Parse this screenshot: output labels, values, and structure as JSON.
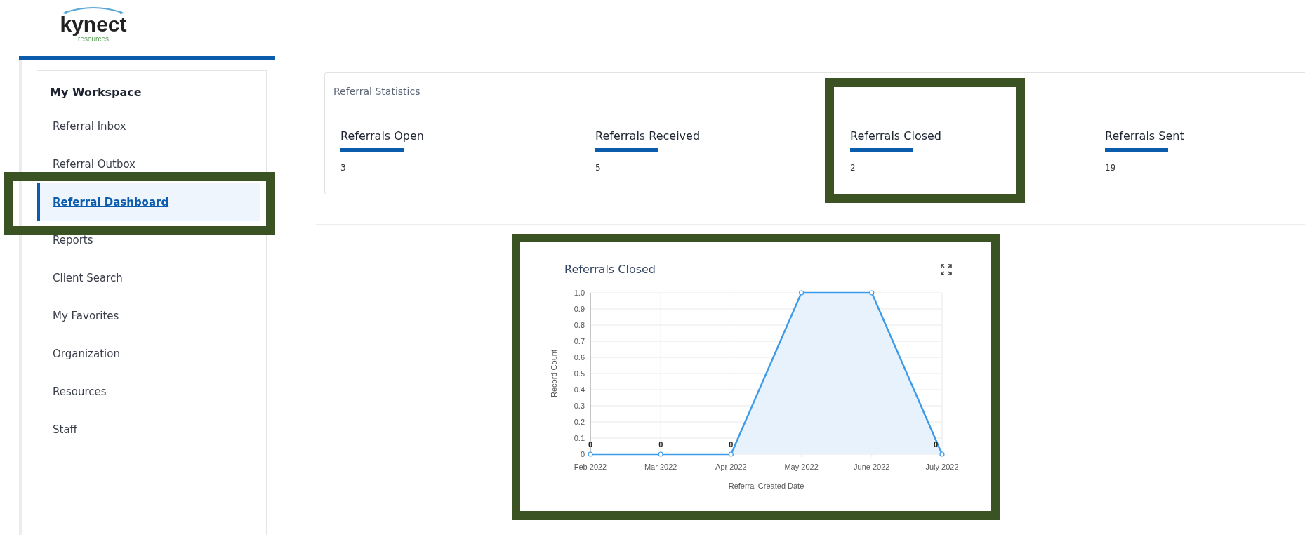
{
  "logo": {
    "name": "kynect",
    "tagline": "resources"
  },
  "sidebar": {
    "heading": "My Workspace",
    "items": [
      {
        "label": "Referral Inbox",
        "selected": false,
        "highlighted": false
      },
      {
        "label": "Referral Outbox",
        "selected": false,
        "highlighted": false
      },
      {
        "label": "Referral Dashboard",
        "selected": true,
        "highlighted": true
      },
      {
        "label": "Reports",
        "selected": false,
        "highlighted": false
      },
      {
        "label": "Client Search",
        "selected": false,
        "highlighted": false
      },
      {
        "label": "My Favorites",
        "selected": false,
        "highlighted": false
      },
      {
        "label": "Organization",
        "selected": false,
        "highlighted": false
      },
      {
        "label": "Resources",
        "selected": false,
        "highlighted": false
      },
      {
        "label": "Staff",
        "selected": false,
        "highlighted": false
      }
    ]
  },
  "statistics": {
    "title": "Referral Statistics",
    "items": [
      {
        "label": "Referrals Open",
        "value": "3",
        "highlighted": false
      },
      {
        "label": "Referrals Received",
        "value": "5",
        "highlighted": false
      },
      {
        "label": "Referrals Closed",
        "value": "2",
        "highlighted": true
      },
      {
        "label": "Referrals Sent",
        "value": "19",
        "highlighted": false
      }
    ]
  },
  "chart_card": {
    "title": "Referrals Closed",
    "highlighted": true,
    "chart_data": {
      "type": "area",
      "xlabel": "Referral Created Date",
      "ylabel": "Record Count",
      "categories": [
        "Feb 2022",
        "Mar 2022",
        "Apr 2022",
        "May 2022",
        "June 2022",
        "July 2022"
      ],
      "series": [
        {
          "color": "#3d9be9",
          "values": [
            0,
            0,
            0,
            1,
            1,
            0
          ]
        }
      ],
      "grid": true,
      "ylim": [
        0,
        1
      ],
      "yticks": [
        {
          "value": 0,
          "label": "0"
        },
        {
          "value": 0.1,
          "label": "0.1"
        },
        {
          "value": 0.2,
          "label": "0.2"
        },
        {
          "value": 0.3,
          "label": "0.3"
        },
        {
          "value": 0.4,
          "label": "0.4"
        },
        {
          "value": 0.5,
          "label": "0.5"
        },
        {
          "value": 0.6,
          "label": "0.6"
        },
        {
          "value": 0.7,
          "label": "0.7"
        },
        {
          "value": 0.8,
          "label": "0.8"
        },
        {
          "value": 0.9,
          "label": "0.9"
        },
        {
          "value": 1,
          "label": "1.0"
        }
      ],
      "value_labels": [
        "0",
        "0",
        "0",
        null,
        null,
        "0"
      ]
    }
  }
}
